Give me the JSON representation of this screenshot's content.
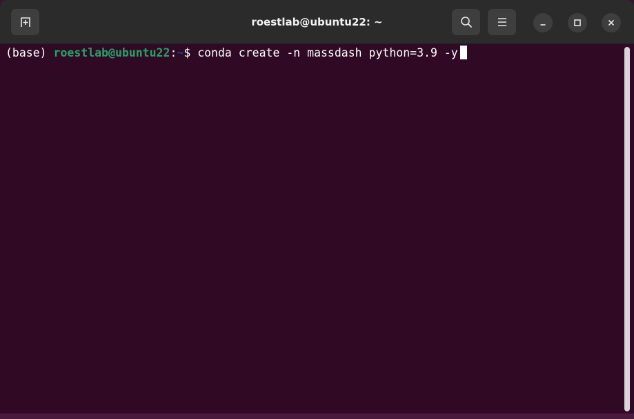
{
  "window": {
    "title": "roestlab@ubuntu22: ~"
  },
  "toolbar": {
    "new_tab_icon": "new-tab-icon",
    "search_icon": "search-icon",
    "menu_icon": "hamburger-menu-icon"
  },
  "window_controls": {
    "minimize_icon": "minimize-icon",
    "maximize_icon": "maximize-icon",
    "close_icon": "close-icon"
  },
  "terminal": {
    "env": "(base) ",
    "user_host": "roestlab@ubuntu22",
    "separator": ":",
    "path": "~",
    "prompt_symbol": "$ ",
    "command": "conda create -n massdash python=3.9 -y"
  },
  "colors": {
    "background": "#300a24",
    "titlebar": "#2b2b2b",
    "prompt_user": "#26a269",
    "prompt_path": "#12488b",
    "text": "#ffffff"
  }
}
